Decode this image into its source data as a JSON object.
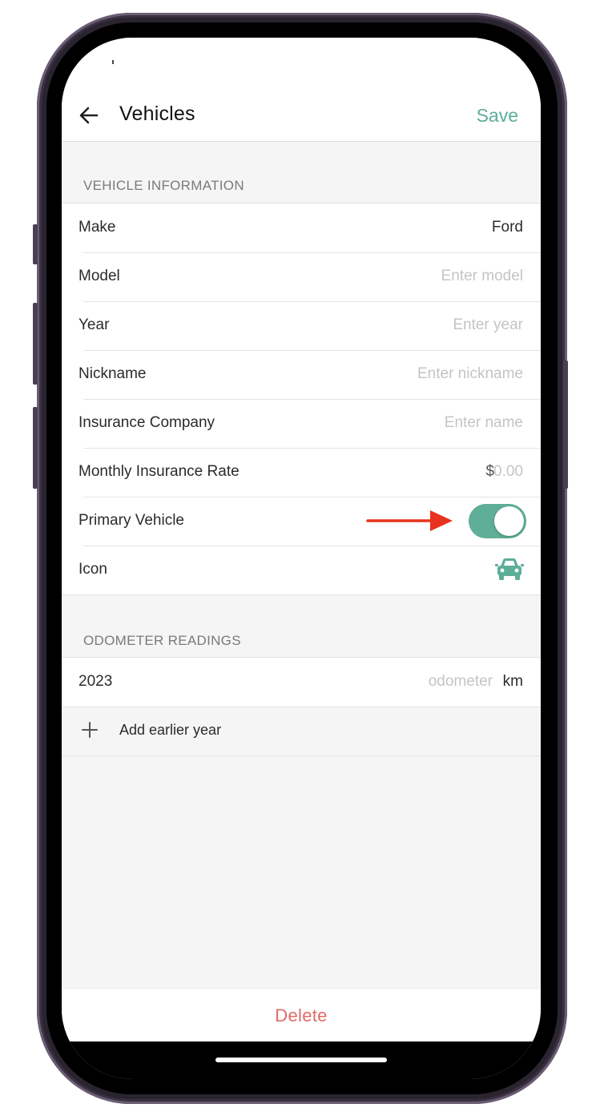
{
  "nav": {
    "title": "Vehicles",
    "save_label": "Save",
    "back_icon": "arrow-left-icon"
  },
  "vehicle_info": {
    "header": "VEHICLE INFORMATION",
    "make_label": "Make",
    "make_value": "Ford",
    "model_label": "Model",
    "model_placeholder": "Enter model",
    "year_label": "Year",
    "year_placeholder": "Enter year",
    "nickname_label": "Nickname",
    "nickname_placeholder": "Enter nickname",
    "insurance_label": "Insurance Company",
    "insurance_placeholder": "Enter name",
    "rate_label": "Monthly Insurance Rate",
    "rate_currency": "$",
    "rate_placeholder": "0.00",
    "primary_label": "Primary Vehicle",
    "primary_on": true,
    "icon_label": "Icon",
    "icon_name": "car-icon"
  },
  "odometer": {
    "header": "ODOMETER READINGS",
    "year": "2023",
    "placeholder": "odometer",
    "unit": "km",
    "add_label": "Add earlier year"
  },
  "footer": {
    "delete_label": "Delete"
  },
  "colors": {
    "accent": "#5cae97",
    "delete": "#e06a66",
    "annotation_arrow": "#e8321e"
  }
}
